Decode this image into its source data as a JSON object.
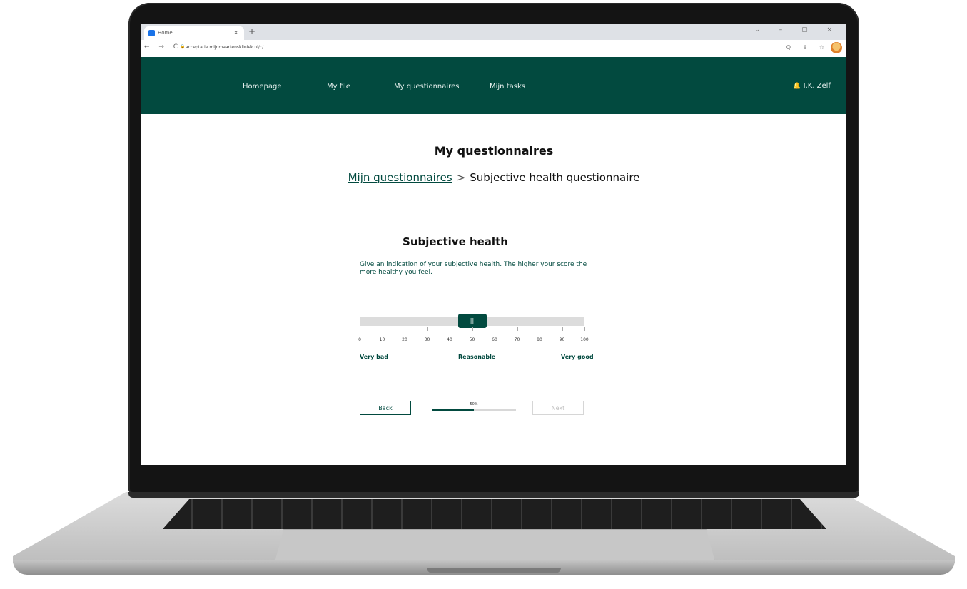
{
  "browser": {
    "tab_title": "Home",
    "tab_close": "×",
    "new_tab": "+",
    "window_controls": "⌄ – ▢ ×",
    "nav_arrows": "← → C",
    "url": "acceptatie.mijnmaartenskliniek.nl/c/",
    "tools": "Q ⇪ ☆"
  },
  "nav": {
    "items": [
      "Homepage",
      "My file",
      "My questionnaires",
      "Mijn tasks"
    ],
    "user": "I.K. Zelf",
    "bell_icon": "🔔"
  },
  "page": {
    "title": "My questionnaires",
    "breadcrumb_link": "Mijn questionnaires",
    "breadcrumb_sep": ">",
    "breadcrumb_current": "Subjective health questionnaire"
  },
  "question": {
    "title": "Subjective health",
    "description": "Give an indication of your subjective health. The higher your score the more healthy you feel.",
    "slider": {
      "value": 50,
      "min": 0,
      "max": 100,
      "ticks": [
        "0",
        "10",
        "20",
        "30",
        "40",
        "50",
        "60",
        "70",
        "80",
        "90",
        "100"
      ],
      "thumb_icon": "||",
      "labels": {
        "low": "Very bad",
        "mid": "Reasonable",
        "high": "Very good"
      }
    }
  },
  "footer": {
    "back_label": "Back",
    "next_label": "Next",
    "progress_percent": 50,
    "progress_label": "50%"
  },
  "colors": {
    "brand": "#024a3f",
    "track": "#dcdcdc"
  }
}
